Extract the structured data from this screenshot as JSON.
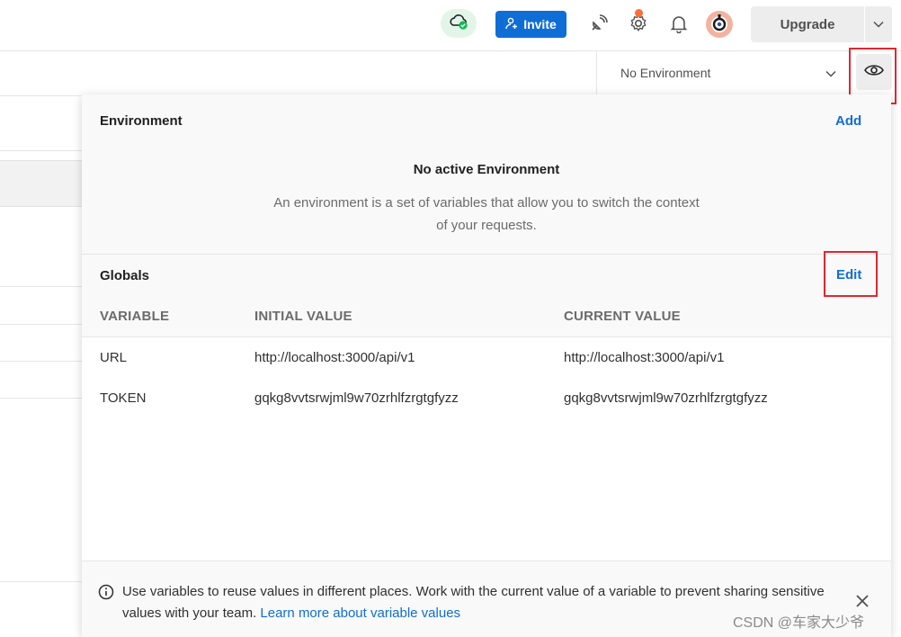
{
  "topbar": {
    "invite_label": "Invite",
    "upgrade_label": "Upgrade"
  },
  "environment_selector": {
    "selected": "No Environment"
  },
  "panel": {
    "environment": {
      "title": "Environment",
      "add_label": "Add",
      "empty_title": "No active Environment",
      "empty_description": "An environment is a set of variables that allow you to switch the context of your requests."
    },
    "globals": {
      "title": "Globals",
      "edit_label": "Edit",
      "columns": [
        "VARIABLE",
        "INITIAL VALUE",
        "CURRENT VALUE"
      ],
      "rows": [
        {
          "variable": "URL",
          "initial": "http://localhost:3000/api/v1",
          "current": "http://localhost:3000/api/v1"
        },
        {
          "variable": "TOKEN",
          "initial": "gqkg8vvtsrwjml9w70zrhlfzrgtgfyzz",
          "current": "gqkg8vvtsrwjml9w70zrhlfzrgtgfyzz"
        }
      ]
    },
    "footer": {
      "text": "Use variables to reuse values in different places. Work with the current value of a variable to prevent sharing sensitive values with your team.",
      "link": "Learn more about variable values"
    }
  },
  "watermark": "CSDN @车家大少爷",
  "colors": {
    "accent": "#0f6ed6",
    "highlight_box": "#e0282e",
    "sync_bg": "#e3f5e9",
    "notification_dot": "#ff6c37"
  },
  "icons": [
    "cloud-sync-icon",
    "add-user-icon",
    "satellite-icon",
    "gear-icon",
    "bell-icon",
    "avatar",
    "chevron-down-icon",
    "eye-icon",
    "info-icon",
    "close-icon"
  ]
}
